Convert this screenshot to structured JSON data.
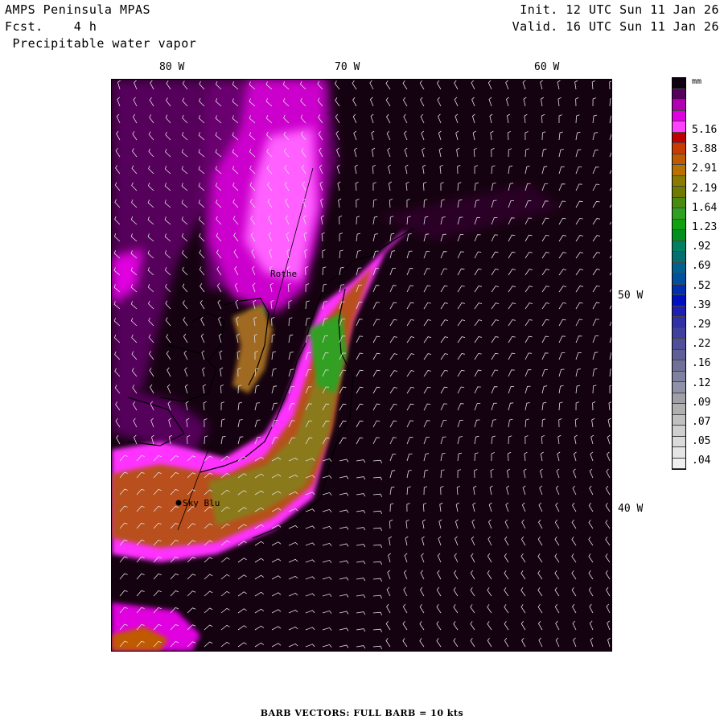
{
  "header": {
    "model": "AMPS Peninsula MPAS",
    "forecast_label": "Fcst.",
    "forecast_value": "4 h",
    "field": "Precipitable water vapor",
    "init": "Init. 12 UTC Sun 11 Jan 26",
    "valid": "Valid. 16 UTC Sun 11 Jan 26"
  },
  "map": {
    "lon_labels": [
      "80 W",
      "70 W",
      "60 W"
    ],
    "lat_labels": [
      "50 W",
      "40 W"
    ],
    "places": [
      {
        "name": "Rothe",
        "marker": false
      },
      {
        "name": "Sky Blu",
        "marker": true
      }
    ]
  },
  "legend": {
    "unit": "mm",
    "labels": [
      "5.16",
      "3.88",
      "2.91",
      "2.19",
      "1.64",
      "1.23",
      ".92",
      ".69",
      ".52",
      ".39",
      ".29",
      ".22",
      ".16",
      ".12",
      ".09",
      ".07",
      ".05",
      ".04"
    ],
    "colors": [
      "#100010",
      "#55005a",
      "#b000b0",
      "#e000e0",
      "#ff40ff",
      "#c00000",
      "#c83a00",
      "#c05a00",
      "#b87000",
      "#8a7a00",
      "#707a00",
      "#4a8a10",
      "#30a020",
      "#10a010",
      "#009020",
      "#008060",
      "#007070",
      "#006090",
      "#0050a0",
      "#0030b0",
      "#0010c0",
      "#2020b0",
      "#3030a8",
      "#4040a0",
      "#50509a",
      "#606098",
      "#707098",
      "#8080a0",
      "#9090a8",
      "#a0a0a8",
      "#b0b0b0",
      "#c0c0c0",
      "#cfcfcf",
      "#dadada",
      "#e5e5e5",
      "#efefef"
    ]
  },
  "footer": "BARB VECTORS:  FULL BARB = 10 kts"
}
